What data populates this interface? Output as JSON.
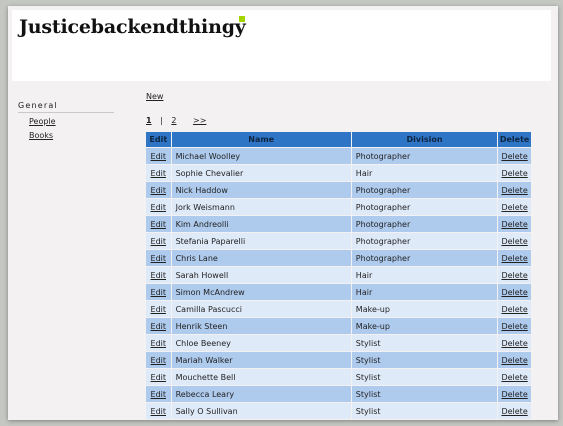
{
  "app": {
    "title": "Justicebackendthingy",
    "accent_color": "#a3d400"
  },
  "sidebar": {
    "heading": "General",
    "items": [
      {
        "label": "People"
      },
      {
        "label": "Books"
      }
    ]
  },
  "actions": {
    "new_label": "New"
  },
  "pager": {
    "current": "1",
    "separator": "|",
    "page2": "2",
    "next": ">>"
  },
  "table": {
    "header_color": "#2e75c6",
    "columns": {
      "edit": "Edit",
      "name": "Name",
      "division": "Division",
      "delete": "Delete"
    },
    "rows": [
      {
        "edit": "Edit",
        "name": "Michael Woolley",
        "division": "Photographer",
        "delete": "Delete"
      },
      {
        "edit": "Edit",
        "name": "Sophie Chevalier",
        "division": "Hair",
        "delete": "Delete"
      },
      {
        "edit": "Edit",
        "name": "Nick Haddow",
        "division": "Photographer",
        "delete": "Delete"
      },
      {
        "edit": "Edit",
        "name": "Jork Weismann",
        "division": "Photographer",
        "delete": "Delete"
      },
      {
        "edit": "Edit",
        "name": "Kim Andreolli",
        "division": "Photographer",
        "delete": "Delete"
      },
      {
        "edit": "Edit",
        "name": "Stefania Paparelli",
        "division": "Photographer",
        "delete": "Delete"
      },
      {
        "edit": "Edit",
        "name": "Chris Lane",
        "division": "Photographer",
        "delete": "Delete"
      },
      {
        "edit": "Edit",
        "name": "Sarah Howell",
        "division": "Hair",
        "delete": "Delete"
      },
      {
        "edit": "Edit",
        "name": "Simon McAndrew",
        "division": "Hair",
        "delete": "Delete"
      },
      {
        "edit": "Edit",
        "name": "Camilla Pascucci",
        "division": "Make-up",
        "delete": "Delete"
      },
      {
        "edit": "Edit",
        "name": "Henrik Steen",
        "division": "Make-up",
        "delete": "Delete"
      },
      {
        "edit": "Edit",
        "name": "Chloe Beeney",
        "division": "Stylist",
        "delete": "Delete"
      },
      {
        "edit": "Edit",
        "name": "Mariah Walker",
        "division": "Stylist",
        "delete": "Delete"
      },
      {
        "edit": "Edit",
        "name": "Mouchette Bell",
        "division": "Stylist",
        "delete": "Delete"
      },
      {
        "edit": "Edit",
        "name": "Rebecca Leary",
        "division": "Stylist",
        "delete": "Delete"
      },
      {
        "edit": "Edit",
        "name": "Sally O Sullivan",
        "division": "Stylist",
        "delete": "Delete"
      }
    ]
  }
}
